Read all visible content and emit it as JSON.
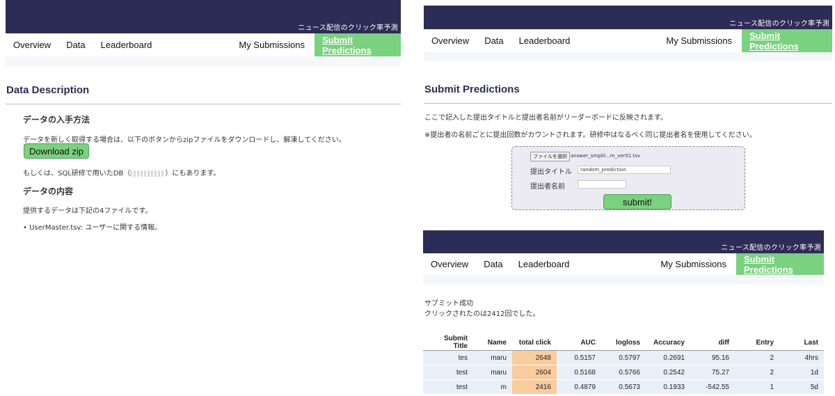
{
  "site_title": "ニュース配信のクリック率予測",
  "nav": {
    "overview": "Overview",
    "data": "Data",
    "leaderboard": "Leaderboard",
    "my_submissions": "My Submissions",
    "submit_predictions": "Submit Predictions"
  },
  "data_page": {
    "heading": "Data Description",
    "section1_title": "データの入手方法",
    "section1_text": "データを新しく取得する場合は、以下のボタンからzipファイルをダウンロードし、解凍してください。",
    "download_label": "Download zip",
    "alt_text_prefix": "もしくは、SQL研修で用いたDB（",
    "alt_text_suffix": "）にもあります。",
    "section2_title": "データの内容",
    "section2_text": "提供するデータは下記の4ファイルです。",
    "file_item": "UserMaster.tsv: ユーザーに関する情報。"
  },
  "submit_page": {
    "heading": "Submit Predictions",
    "line1": "ここで記入した提出タイトルと提出者名前がリーダーボードに反映されます。",
    "line2": "※提出者の名前ごとに提出回数がカウントされます。研修中はなるべく同じ提出者名を使用してください。",
    "file_button": "ファイルを選択",
    "file_name": "answer_smpl0...m_ver01.tsv",
    "title_label": "提出タイトル",
    "title_value": "random_prediction",
    "name_label": "提出者名前",
    "submit_label": "submit!"
  },
  "result_page": {
    "success": "サブミット成功",
    "clicks": "クリックされたのは2412回でした。",
    "columns": [
      "Submit Title",
      "Name",
      "total click",
      "AUC",
      "logloss",
      "Accuracy",
      "diff",
      "Entry",
      "Last"
    ],
    "rows": [
      [
        "tes",
        "maru",
        "2648",
        "0.5157",
        "0.5797",
        "0.2691",
        "95.16",
        "2",
        "4hrs"
      ],
      [
        "test",
        "maru",
        "2604",
        "0.5168",
        "0.5766",
        "0.2542",
        "75.27",
        "2",
        "1d"
      ],
      [
        "test",
        "m",
        "2416",
        "0.4879",
        "0.5673",
        "0.1933",
        "-542.55",
        "1",
        "5d"
      ]
    ]
  },
  "colors": {
    "banner": "#2d2c56",
    "nav_active": "#7ad17f",
    "heading": "#2d2c56",
    "highlight_column": "#f9cc9e",
    "row_bg": "#e9eff8"
  }
}
